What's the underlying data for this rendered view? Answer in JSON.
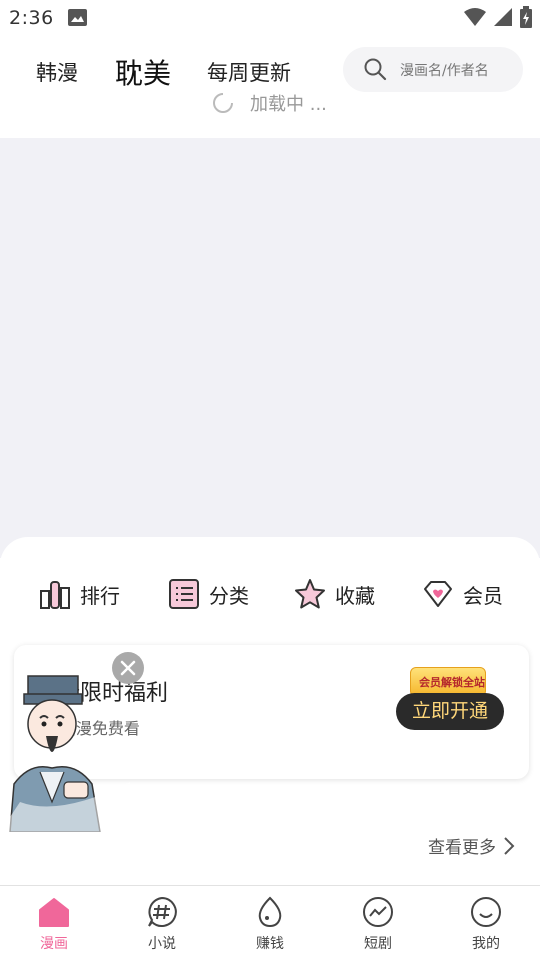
{
  "status_bar": {
    "time": "2:36",
    "icons": [
      "image-icon",
      "wifi-icon",
      "signal-icon",
      "battery-icon"
    ]
  },
  "top_nav": {
    "tabs": [
      {
        "label": "韩漫",
        "active": false
      },
      {
        "label": "耽美",
        "active": true
      },
      {
        "label": "每周更新",
        "active": false
      }
    ],
    "search_placeholder": "漫画名/作者名"
  },
  "loading": {
    "text": "加载中 ..."
  },
  "quick_links": [
    {
      "label": "排行",
      "icon": "ranking-icon"
    },
    {
      "label": "分类",
      "icon": "category-list-icon"
    },
    {
      "label": "收藏",
      "icon": "star-icon"
    },
    {
      "label": "会员",
      "icon": "vip-heart-icon"
    }
  ],
  "promo": {
    "title": "萌新限时福利",
    "subtitle": "K+国漫免费看",
    "badge": "会员解锁全站",
    "button": "立即开通"
  },
  "more_link": "查看更多",
  "bottom_nav": [
    {
      "label": "漫画",
      "icon": "home-icon",
      "active": true
    },
    {
      "label": "小说",
      "icon": "hashtag-icon",
      "active": false
    },
    {
      "label": "赚钱",
      "icon": "egg-icon",
      "active": false
    },
    {
      "label": "短剧",
      "icon": "trend-icon",
      "active": false
    },
    {
      "label": "我的",
      "icon": "smile-icon",
      "active": false
    }
  ],
  "colors": {
    "accent": "#f0679a",
    "banner_bg": "#f1f1f6",
    "button_bg": "#2a2a2a",
    "button_text": "#ffd77a"
  }
}
